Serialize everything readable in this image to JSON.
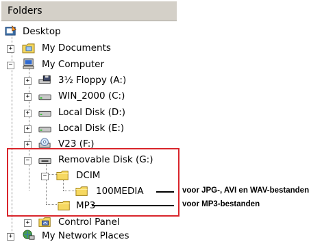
{
  "header": {
    "title": "Folders"
  },
  "tree": {
    "desktop": "Desktop",
    "my_documents": "My Documents",
    "my_computer": "My Computer",
    "floppy": "3½ Floppy (A:)",
    "win2000": "WIN_2000 (C:)",
    "disk_d": "Local Disk (D:)",
    "disk_e": "Local Disk (E:)",
    "v23": "V23 (F:)",
    "removable": "Removable Disk (G:)",
    "dcim": "DCIM",
    "media100": "100MEDIA",
    "mp3": "MP3",
    "control_panel": "Control Panel",
    "network": "My Network Places"
  },
  "expanders": {
    "plus": "+",
    "minus": "−"
  },
  "annotations": {
    "media_note": "voor JPG-, AVI en WAV-bestanden",
    "mp3_note": "voor MP3-bestanden"
  },
  "colors": {
    "highlight": "#d9252b",
    "folder": "#f6d860",
    "panel": "#d4d0c8"
  }
}
